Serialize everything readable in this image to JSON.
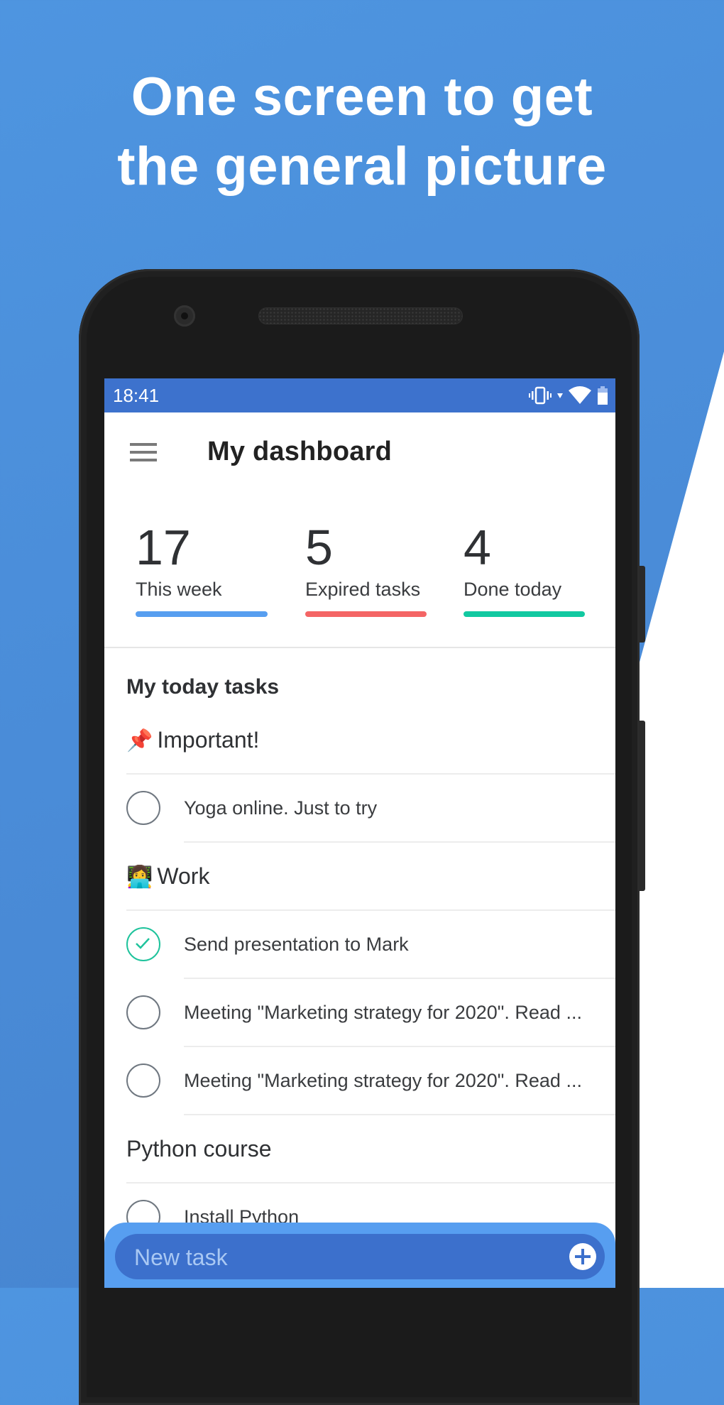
{
  "promo": {
    "headline_line1": "One screen to get",
    "headline_line2": "the general picture"
  },
  "status_bar": {
    "time": "18:41",
    "icons": [
      "vibrate-icon",
      "signal-arrow-icon",
      "wifi-icon",
      "battery-icon"
    ]
  },
  "app_bar": {
    "menu_icon": "hamburger-menu-icon",
    "title": "My dashboard"
  },
  "stats": [
    {
      "value": "17",
      "label": "This week",
      "color": "#579ef0"
    },
    {
      "value": "5",
      "label": "Expired tasks",
      "color": "#f46565"
    },
    {
      "value": "4",
      "label": "Done today",
      "color": "#12c9a1"
    }
  ],
  "today": {
    "title": "My today tasks",
    "groups": [
      {
        "emoji": "📌",
        "name": "Important!",
        "tasks": [
          {
            "text": "Yoga online. Just to try",
            "done": false
          }
        ]
      },
      {
        "emoji": "👩‍💻",
        "name": "Work",
        "tasks": [
          {
            "text": "Send presentation to Mark",
            "done": true
          },
          {
            "text": "Meeting \"Marketing strategy for 2020\". Read ...",
            "done": false
          },
          {
            "text": "Meeting \"Marketing strategy for 2020\". Read ...",
            "done": false
          }
        ]
      },
      {
        "emoji": "",
        "name": "Python course",
        "tasks": [
          {
            "text": "Install Python",
            "done": false
          }
        ]
      }
    ]
  },
  "new_task": {
    "placeholder": "New task",
    "value": "",
    "add_icon": "plus-circle-icon"
  },
  "colors": {
    "status_bar": "#3d72cd",
    "accent": "#579ef0",
    "done_check": "#1fc39c"
  }
}
